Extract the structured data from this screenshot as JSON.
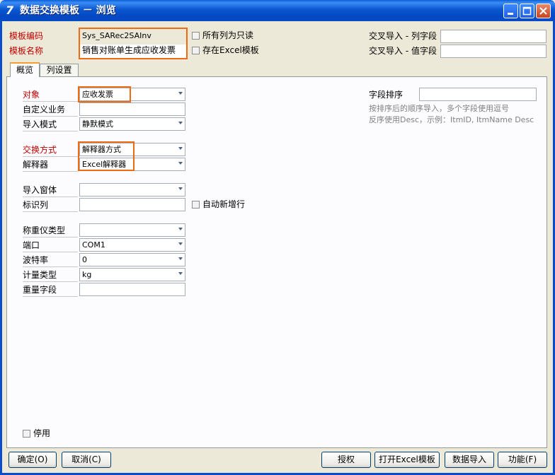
{
  "window": {
    "title": "数据交换模板 － 浏览",
    "app_icon": "7"
  },
  "header": {
    "template_code_label": "模板编码",
    "template_code_value": "Sys_SARec2SAInv",
    "template_name_label": "模板名称",
    "template_name_value": "销售对账单生成应收发票",
    "all_readonly_label": "所有列为只读",
    "excel_template_label": "存在Excel模板",
    "cross_col_label": "交叉导入 - 列字段",
    "cross_val_label": "交叉导入 - 值字段",
    "cross_col_value": "",
    "cross_val_value": ""
  },
  "tabs": [
    {
      "label": "概览",
      "active": true
    },
    {
      "label": "列设置",
      "active": false
    }
  ],
  "form": {
    "object_label": "对象",
    "object_value": "应收发票",
    "custom_business_label": "自定义业务",
    "custom_business_value": "",
    "import_mode_label": "导入模式",
    "import_mode_value": "静默模式",
    "exchange_method_label": "交换方式",
    "exchange_method_value": "解释器方式",
    "parser_label": "解释器",
    "parser_value": "Excel解释器",
    "import_form_label": "导入窗体",
    "import_form_value": "",
    "id_column_label": "标识列",
    "id_column_value": "",
    "auto_new_row_label": "自动新增行",
    "scale_type_label": "称重仪类型",
    "scale_type_value": "",
    "port_label": "端口",
    "port_value": "COM1",
    "baud_label": "波特率",
    "baud_value": "0",
    "unit_type_label": "计量类型",
    "unit_type_value": "kg",
    "weight_field_label": "重量字段",
    "weight_field_value": "",
    "sort_label": "字段排序",
    "sort_value": "",
    "sort_hint_1": "按排序后的顺序导入，多个字段使用逗号",
    "sort_hint_2": "反序使用Desc，示例：ItmID, ItmName Desc",
    "disabled_label": "停用"
  },
  "buttons": {
    "ok": "确定(O)",
    "cancel": "取消(C)",
    "authorize": "授权",
    "open_excel": "打开Excel模板",
    "data_import": "数据导入",
    "function": "功能(F)"
  },
  "colors": {
    "titlebar": "#0a57d0",
    "required_label": "#c00000",
    "highlight_border": "#f06a12",
    "window_bg": "#ece9d8"
  }
}
